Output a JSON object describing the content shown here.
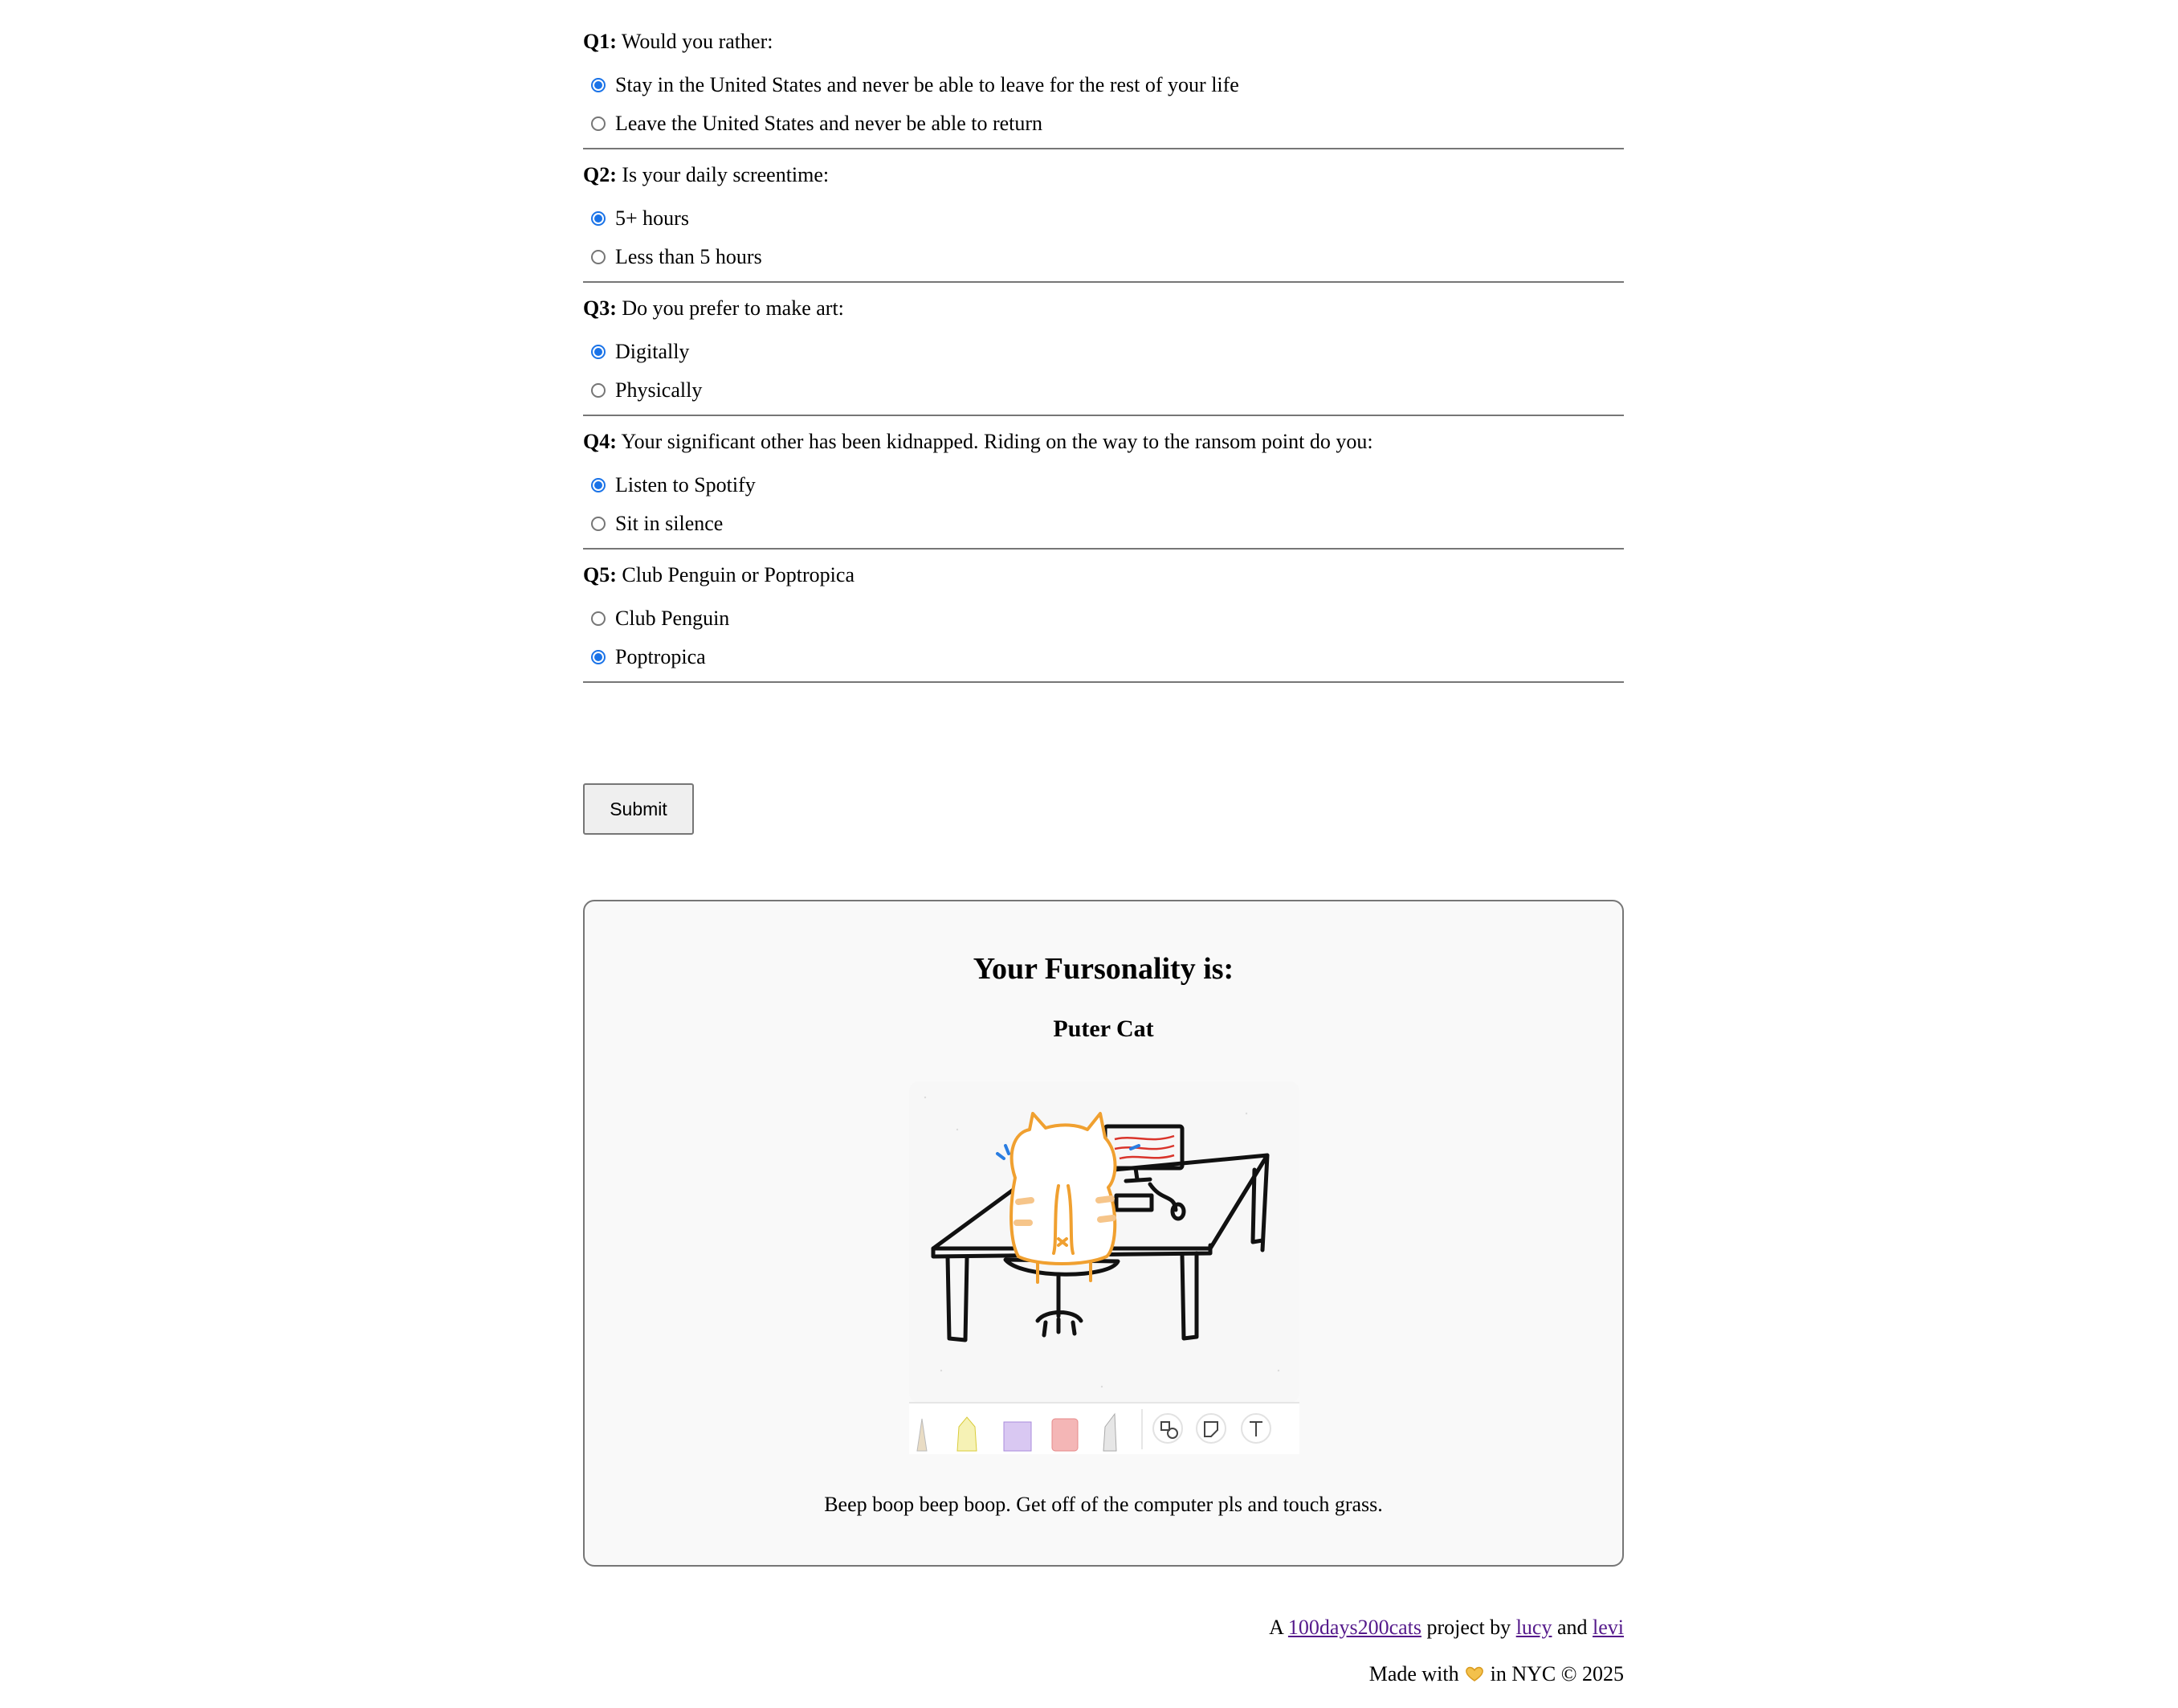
{
  "questions": [
    {
      "num": "Q1:",
      "text": "Would you rather:",
      "options": [
        {
          "label": "Stay in the United States and never be able to leave for the rest of your life",
          "selected": true
        },
        {
          "label": "Leave the United States and never be able to return",
          "selected": false
        }
      ]
    },
    {
      "num": "Q2:",
      "text": "Is your daily screentime:",
      "options": [
        {
          "label": "5+ hours",
          "selected": true
        },
        {
          "label": "Less than 5 hours",
          "selected": false
        }
      ]
    },
    {
      "num": "Q3:",
      "text": "Do you prefer to make art:",
      "options": [
        {
          "label": "Digitally",
          "selected": true
        },
        {
          "label": "Physically",
          "selected": false
        }
      ]
    },
    {
      "num": "Q4:",
      "text": "Your significant other has been kidnapped. Riding on the way to the ransom point do you:",
      "options": [
        {
          "label": "Listen to Spotify",
          "selected": true
        },
        {
          "label": "Sit in silence",
          "selected": false
        }
      ]
    },
    {
      "num": "Q5:",
      "text": "Club Penguin or Poptropica",
      "options": [
        {
          "label": "Club Penguin",
          "selected": false
        },
        {
          "label": "Poptropica",
          "selected": true
        }
      ]
    }
  ],
  "submit_label": "Submit",
  "result": {
    "heading": "Your Fursonality is:",
    "name": "Puter Cat",
    "image_icon": "cat-at-computer-drawing",
    "description": "Beep boop beep boop. Get off of the computer pls and touch grass."
  },
  "footer": {
    "line1_prefix": "A",
    "project_link": "100days200cats",
    "by_text": "project by",
    "author1": "lucy",
    "and_text": "and",
    "author2": "levi",
    "made_with": "Made with",
    "heart_icon": "heart-hands-icon",
    "made_suffix": "in NYC © 2025"
  },
  "colors": {
    "accent": "#1a73e8",
    "link": "#551a8b",
    "border": "#767676",
    "card_bg": "#f9f9f9"
  }
}
